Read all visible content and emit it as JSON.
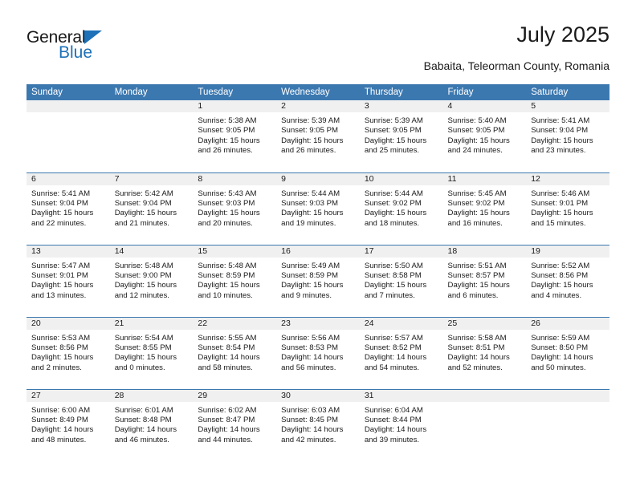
{
  "brand": {
    "name_part1": "General",
    "name_part2": "Blue",
    "accent_color": "#1d71b8"
  },
  "header": {
    "title": "July 2025",
    "subtitle": "Babaita, Teleorman County, Romania"
  },
  "theme": {
    "header_blue": "#3c78b0",
    "daynum_band": "#f0f0f0",
    "text": "#1a1a1a"
  },
  "calendar": {
    "weekday_headers": [
      "Sunday",
      "Monday",
      "Tuesday",
      "Wednesday",
      "Thursday",
      "Friday",
      "Saturday"
    ],
    "weeks": [
      [
        {
          "day": "",
          "lines": []
        },
        {
          "day": "",
          "lines": []
        },
        {
          "day": "1",
          "lines": [
            "Sunrise: 5:38 AM",
            "Sunset: 9:05 PM",
            "Daylight: 15 hours",
            "and 26 minutes."
          ]
        },
        {
          "day": "2",
          "lines": [
            "Sunrise: 5:39 AM",
            "Sunset: 9:05 PM",
            "Daylight: 15 hours",
            "and 26 minutes."
          ]
        },
        {
          "day": "3",
          "lines": [
            "Sunrise: 5:39 AM",
            "Sunset: 9:05 PM",
            "Daylight: 15 hours",
            "and 25 minutes."
          ]
        },
        {
          "day": "4",
          "lines": [
            "Sunrise: 5:40 AM",
            "Sunset: 9:05 PM",
            "Daylight: 15 hours",
            "and 24 minutes."
          ]
        },
        {
          "day": "5",
          "lines": [
            "Sunrise: 5:41 AM",
            "Sunset: 9:04 PM",
            "Daylight: 15 hours",
            "and 23 minutes."
          ]
        }
      ],
      [
        {
          "day": "6",
          "lines": [
            "Sunrise: 5:41 AM",
            "Sunset: 9:04 PM",
            "Daylight: 15 hours",
            "and 22 minutes."
          ]
        },
        {
          "day": "7",
          "lines": [
            "Sunrise: 5:42 AM",
            "Sunset: 9:04 PM",
            "Daylight: 15 hours",
            "and 21 minutes."
          ]
        },
        {
          "day": "8",
          "lines": [
            "Sunrise: 5:43 AM",
            "Sunset: 9:03 PM",
            "Daylight: 15 hours",
            "and 20 minutes."
          ]
        },
        {
          "day": "9",
          "lines": [
            "Sunrise: 5:44 AM",
            "Sunset: 9:03 PM",
            "Daylight: 15 hours",
            "and 19 minutes."
          ]
        },
        {
          "day": "10",
          "lines": [
            "Sunrise: 5:44 AM",
            "Sunset: 9:02 PM",
            "Daylight: 15 hours",
            "and 18 minutes."
          ]
        },
        {
          "day": "11",
          "lines": [
            "Sunrise: 5:45 AM",
            "Sunset: 9:02 PM",
            "Daylight: 15 hours",
            "and 16 minutes."
          ]
        },
        {
          "day": "12",
          "lines": [
            "Sunrise: 5:46 AM",
            "Sunset: 9:01 PM",
            "Daylight: 15 hours",
            "and 15 minutes."
          ]
        }
      ],
      [
        {
          "day": "13",
          "lines": [
            "Sunrise: 5:47 AM",
            "Sunset: 9:01 PM",
            "Daylight: 15 hours",
            "and 13 minutes."
          ]
        },
        {
          "day": "14",
          "lines": [
            "Sunrise: 5:48 AM",
            "Sunset: 9:00 PM",
            "Daylight: 15 hours",
            "and 12 minutes."
          ]
        },
        {
          "day": "15",
          "lines": [
            "Sunrise: 5:48 AM",
            "Sunset: 8:59 PM",
            "Daylight: 15 hours",
            "and 10 minutes."
          ]
        },
        {
          "day": "16",
          "lines": [
            "Sunrise: 5:49 AM",
            "Sunset: 8:59 PM",
            "Daylight: 15 hours",
            "and 9 minutes."
          ]
        },
        {
          "day": "17",
          "lines": [
            "Sunrise: 5:50 AM",
            "Sunset: 8:58 PM",
            "Daylight: 15 hours",
            "and 7 minutes."
          ]
        },
        {
          "day": "18",
          "lines": [
            "Sunrise: 5:51 AM",
            "Sunset: 8:57 PM",
            "Daylight: 15 hours",
            "and 6 minutes."
          ]
        },
        {
          "day": "19",
          "lines": [
            "Sunrise: 5:52 AM",
            "Sunset: 8:56 PM",
            "Daylight: 15 hours",
            "and 4 minutes."
          ]
        }
      ],
      [
        {
          "day": "20",
          "lines": [
            "Sunrise: 5:53 AM",
            "Sunset: 8:56 PM",
            "Daylight: 15 hours",
            "and 2 minutes."
          ]
        },
        {
          "day": "21",
          "lines": [
            "Sunrise: 5:54 AM",
            "Sunset: 8:55 PM",
            "Daylight: 15 hours",
            "and 0 minutes."
          ]
        },
        {
          "day": "22",
          "lines": [
            "Sunrise: 5:55 AM",
            "Sunset: 8:54 PM",
            "Daylight: 14 hours",
            "and 58 minutes."
          ]
        },
        {
          "day": "23",
          "lines": [
            "Sunrise: 5:56 AM",
            "Sunset: 8:53 PM",
            "Daylight: 14 hours",
            "and 56 minutes."
          ]
        },
        {
          "day": "24",
          "lines": [
            "Sunrise: 5:57 AM",
            "Sunset: 8:52 PM",
            "Daylight: 14 hours",
            "and 54 minutes."
          ]
        },
        {
          "day": "25",
          "lines": [
            "Sunrise: 5:58 AM",
            "Sunset: 8:51 PM",
            "Daylight: 14 hours",
            "and 52 minutes."
          ]
        },
        {
          "day": "26",
          "lines": [
            "Sunrise: 5:59 AM",
            "Sunset: 8:50 PM",
            "Daylight: 14 hours",
            "and 50 minutes."
          ]
        }
      ],
      [
        {
          "day": "27",
          "lines": [
            "Sunrise: 6:00 AM",
            "Sunset: 8:49 PM",
            "Daylight: 14 hours",
            "and 48 minutes."
          ]
        },
        {
          "day": "28",
          "lines": [
            "Sunrise: 6:01 AM",
            "Sunset: 8:48 PM",
            "Daylight: 14 hours",
            "and 46 minutes."
          ]
        },
        {
          "day": "29",
          "lines": [
            "Sunrise: 6:02 AM",
            "Sunset: 8:47 PM",
            "Daylight: 14 hours",
            "and 44 minutes."
          ]
        },
        {
          "day": "30",
          "lines": [
            "Sunrise: 6:03 AM",
            "Sunset: 8:45 PM",
            "Daylight: 14 hours",
            "and 42 minutes."
          ]
        },
        {
          "day": "31",
          "lines": [
            "Sunrise: 6:04 AM",
            "Sunset: 8:44 PM",
            "Daylight: 14 hours",
            "and 39 minutes."
          ]
        },
        {
          "day": "",
          "lines": []
        },
        {
          "day": "",
          "lines": []
        }
      ]
    ]
  }
}
